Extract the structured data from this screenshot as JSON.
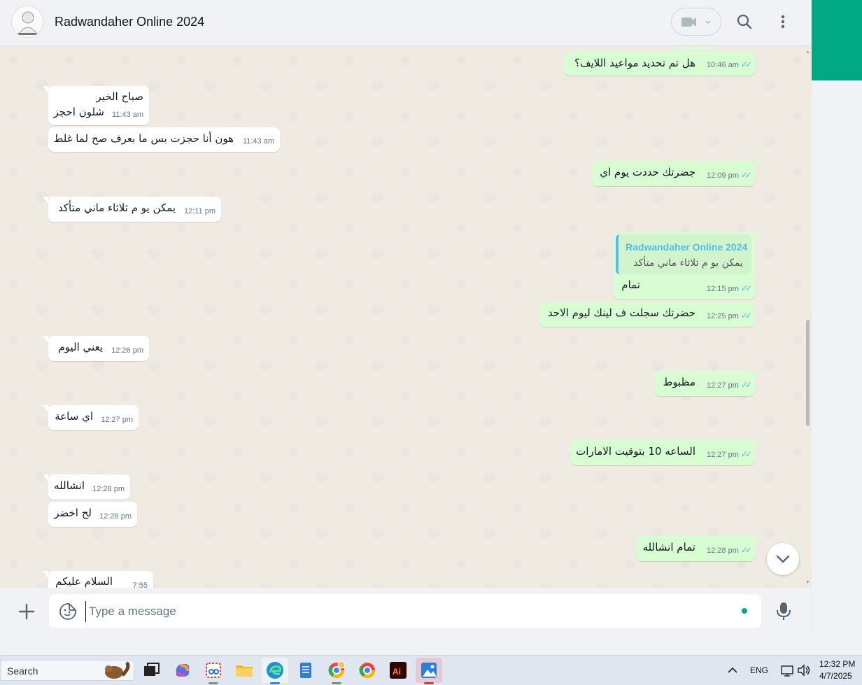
{
  "header": {
    "contact_name": "Radwandaher Online 2024"
  },
  "messages": [
    {
      "dir": "out",
      "text": "هل تم تحديد مواعيد اللايف؟",
      "time": "10:46 am"
    },
    {
      "dir": "in",
      "lines": [
        "صباح الخير",
        "شلون احجز"
      ],
      "time": "11:43 am"
    },
    {
      "dir": "in",
      "text": "هون أنا حجزت بس ما بعرف صح لما غلط",
      "time": "11:43 am"
    },
    {
      "dir": "out",
      "text": "جضرتك حددت يوم اي",
      "time": "12:09 pm"
    },
    {
      "dir": "in",
      "text": "يمكن يو م ثلاثاء ماني متأكد",
      "time": "12:11 pm"
    },
    {
      "dir": "out",
      "quote_author": "Radwandaher Online 2024",
      "quote_text": "يمكن يو م ثلاثاء ماني متأكد",
      "text": "تمام",
      "time": "12:15 pm"
    },
    {
      "dir": "out",
      "text": "حضرتك سجلت ف لينك ليوم الاحد",
      "time": "12:25 pm"
    },
    {
      "dir": "in",
      "text": "يعني اليوم",
      "time": "12:26 pm"
    },
    {
      "dir": "out",
      "text": "مظبوط",
      "time": "12:27 pm"
    },
    {
      "dir": "in",
      "text": "اي ساعة",
      "time": "12:27 pm"
    },
    {
      "dir": "out",
      "text": "الساعه 10 بتوقيت الامارات",
      "time": "12:27 pm"
    },
    {
      "dir": "in",
      "text": "انشالله",
      "time": "12:28 pm"
    },
    {
      "dir": "in",
      "text": "لح اخضر",
      "time": "12:28 pm"
    },
    {
      "dir": "out",
      "text": "تمام انشالله",
      "time": "12:28 pm"
    },
    {
      "dir": "in",
      "text": "السلام عليكم",
      "time": "7:55"
    }
  ],
  "composer": {
    "placeholder": "Type a message"
  },
  "taskbar": {
    "search_label": "Search",
    "language": "ENG",
    "time": "12:32 PM",
    "date": "4/7/2025"
  },
  "colors": {
    "accent": "#00a884",
    "outgoing_bubble": "#d9fdd3",
    "incoming_bubble": "#ffffff",
    "chat_background": "#efeae2",
    "read_tick": "#53bdeb"
  }
}
